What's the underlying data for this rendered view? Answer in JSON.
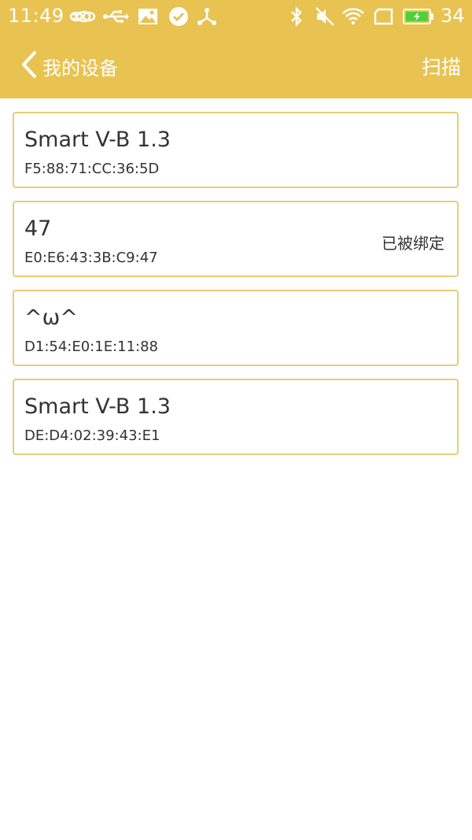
{
  "status_bar": {
    "time": "11:49",
    "battery_level": "34",
    "icons": [
      "infinity-icon",
      "usb-icon",
      "image-icon",
      "check-circle-icon",
      "share-icon",
      "bluetooth-icon",
      "mute-icon",
      "wifi-icon",
      "sim-icon",
      "battery-icon"
    ]
  },
  "nav": {
    "back_label": "我的设备",
    "scan_label": "扫描"
  },
  "devices": [
    {
      "name": "Smart V-B 1.3",
      "mac": "F5:88:71:CC:36:5D",
      "status": ""
    },
    {
      "name": "47",
      "mac": "E0:E6:43:3B:C9:47",
      "status": "已被绑定"
    },
    {
      "name": "^ω^",
      "mac": "D1:54:E0:1E:11:88",
      "status": ""
    },
    {
      "name": "Smart V-B 1.3",
      "mac": "DE:D4:02:39:43:E1",
      "status": ""
    }
  ],
  "colors": {
    "header": "#e8c352",
    "card_border": "#e6cd79",
    "text": "#333333",
    "header_text": "#ffffff"
  }
}
